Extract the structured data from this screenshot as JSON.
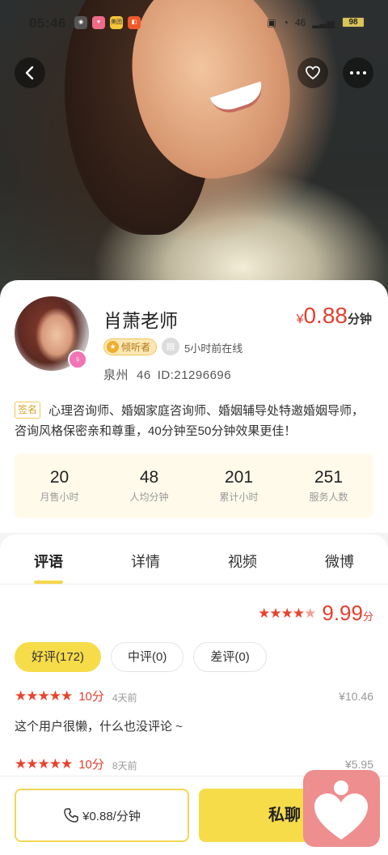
{
  "status_bar": {
    "time": "05:46",
    "app1": "美团",
    "battery": "98",
    "signal": "46"
  },
  "profile": {
    "name": "肖萧老师",
    "price_currency": "¥",
    "price_value": "0.88",
    "price_unit": "分钟",
    "listener_tag": "倾听者",
    "online_status": "5小时前在线",
    "city": "泉州",
    "age": "46",
    "id": "ID:21296696",
    "sign_tag": "签名",
    "signature": "心理咨询师、婚姻家庭咨询师、婚姻辅导处特邀婚姻导师，咨询风格保密亲和尊重，40分钟至50分钟效果更佳！"
  },
  "stats": [
    {
      "value": "20",
      "label": "月售小时"
    },
    {
      "value": "48",
      "label": "人均分钟"
    },
    {
      "value": "201",
      "label": "累计小时"
    },
    {
      "value": "251",
      "label": "服务人数"
    }
  ],
  "tabs": [
    {
      "label": "评语",
      "active": true
    },
    {
      "label": "详情",
      "active": false
    },
    {
      "label": "视频",
      "active": false
    },
    {
      "label": "微博",
      "active": false
    }
  ],
  "rating": {
    "score": "9.99",
    "unit": "分",
    "stars": 4.5
  },
  "filters": [
    {
      "label": "好评(172)",
      "active": true
    },
    {
      "label": "中评(0)",
      "active": false
    },
    {
      "label": "差评(0)",
      "active": false
    }
  ],
  "reviews": [
    {
      "stars": 5,
      "score": "10分",
      "time": "4天前",
      "amount": "¥10.46",
      "text": "这个用户很懒，什么也没评论 ~"
    },
    {
      "stars": 5,
      "score": "10分",
      "time": "8天前",
      "amount": "¥5.95",
      "text": ""
    }
  ],
  "bottom": {
    "call_label": "¥0.88/分钟",
    "chat_label": "私聊"
  },
  "colors": {
    "accent_yellow": "#f7dc4a",
    "price_red": "#e3402f",
    "star_red": "#e8432d"
  }
}
